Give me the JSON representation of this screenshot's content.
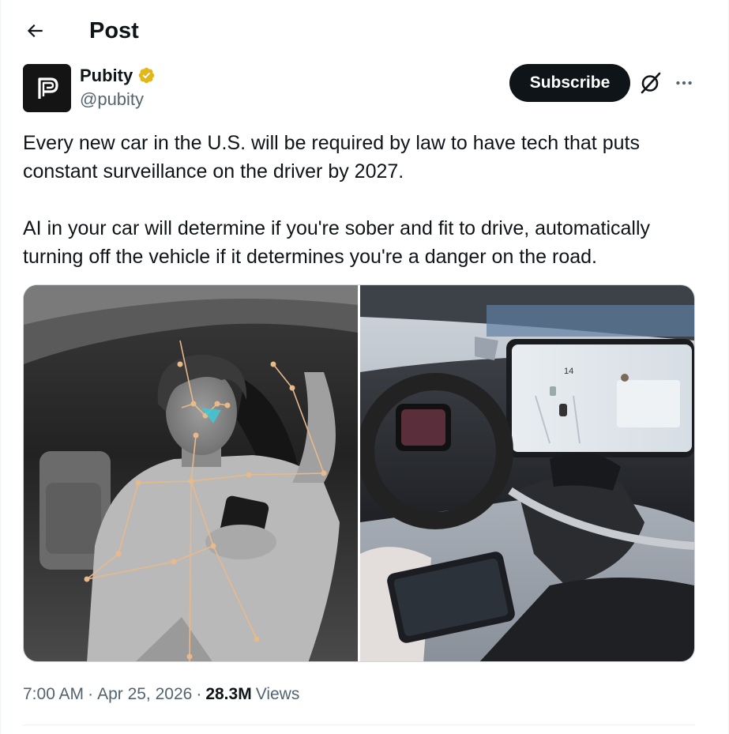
{
  "header": {
    "title": "Post",
    "back_icon": "arrow-left-icon"
  },
  "author": {
    "name": "Pubity",
    "handle": "@pubity",
    "avatar_letter": "P",
    "verified_icon": "verified-gold-badge-icon",
    "verified_color": "#e2b719"
  },
  "actions": {
    "subscribe_label": "Subscribe",
    "grok_icon": "grok-icon",
    "more_icon": "more-horizontal-icon"
  },
  "tweet": {
    "paragraphs": [
      "Every new car in the U.S. will be required by law to have tech that puts constant surveillance on the driver by 2027.",
      "AI in your car will determine if you're sober and fit to drive, automatically turning off the vehicle if it determines you're a danger on the road."
    ]
  },
  "media": {
    "images": [
      {
        "name": "driver-monitoring-photo"
      },
      {
        "name": "car-interior-photo"
      }
    ],
    "screen_speed": "14"
  },
  "meta": {
    "time": "7:00 AM",
    "separator": "·",
    "date": "Apr 25, 2026",
    "views_count": "28.3M",
    "views_label": "Views"
  },
  "colors": {
    "text_primary": "#0f1419",
    "text_secondary": "#536471",
    "border": "#cfd9de",
    "divider": "#eff3f4"
  }
}
